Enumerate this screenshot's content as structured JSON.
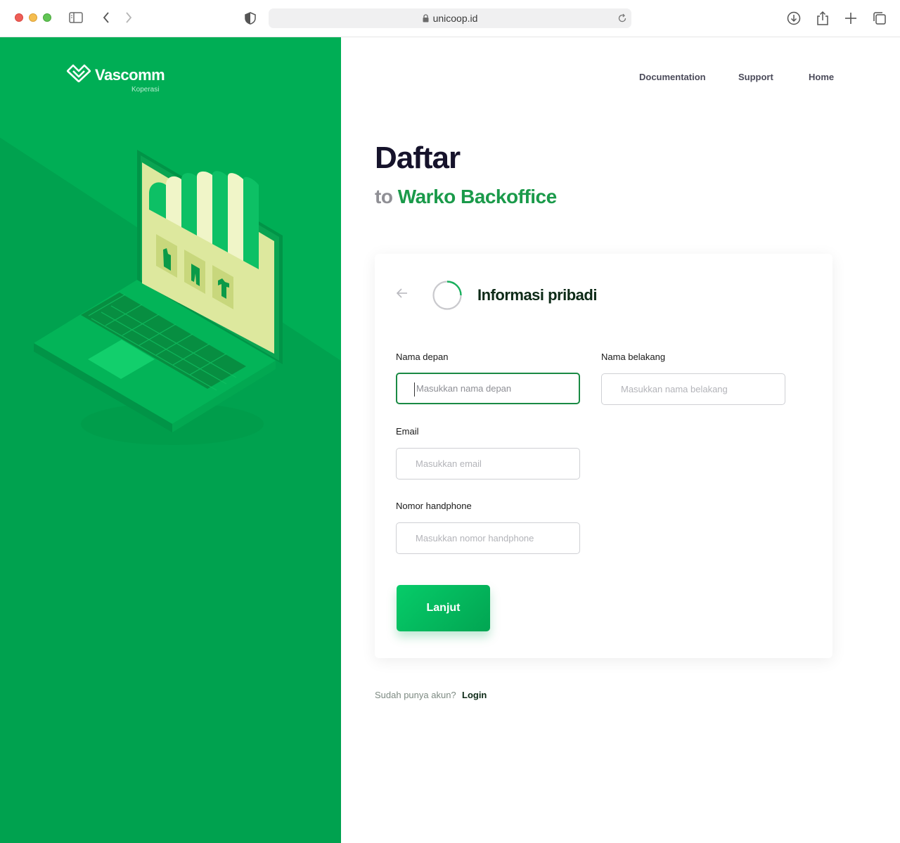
{
  "browser": {
    "url": "unicoop.id"
  },
  "brand": {
    "name": "Vascomm",
    "tagline": "Koperasi",
    "primary_color": "#00a24f",
    "accent_color": "#1a9a4a"
  },
  "nav": {
    "items": [
      "Documentation",
      "Support",
      "Home"
    ]
  },
  "header": {
    "title": "Daftar",
    "subtitle_prefix": "to",
    "subtitle_app": "Warko Backoffice"
  },
  "form": {
    "step_title": "Informasi pribadi",
    "first_name": {
      "label": "Nama depan",
      "placeholder": "Masukkan nama depan",
      "value": ""
    },
    "last_name": {
      "label": "Nama belakang",
      "placeholder": "Masukkan nama belakang",
      "value": ""
    },
    "email": {
      "label": "Email",
      "placeholder": "Masukkan email",
      "value": ""
    },
    "phone": {
      "label": "Nomor handphone",
      "placeholder": "Masukkan nomor handphone",
      "value": ""
    },
    "submit_label": "Lanjut"
  },
  "footer": {
    "question": "Sudah punya akun?",
    "login_label": "Login"
  },
  "icons": [
    "sidebar-icon",
    "back-icon",
    "forward-icon",
    "shield-icon",
    "lock-icon",
    "reload-icon",
    "download-icon",
    "share-icon",
    "new-tab-icon",
    "tabs-icon",
    "arrow-left-icon",
    "progress-ring-icon"
  ]
}
